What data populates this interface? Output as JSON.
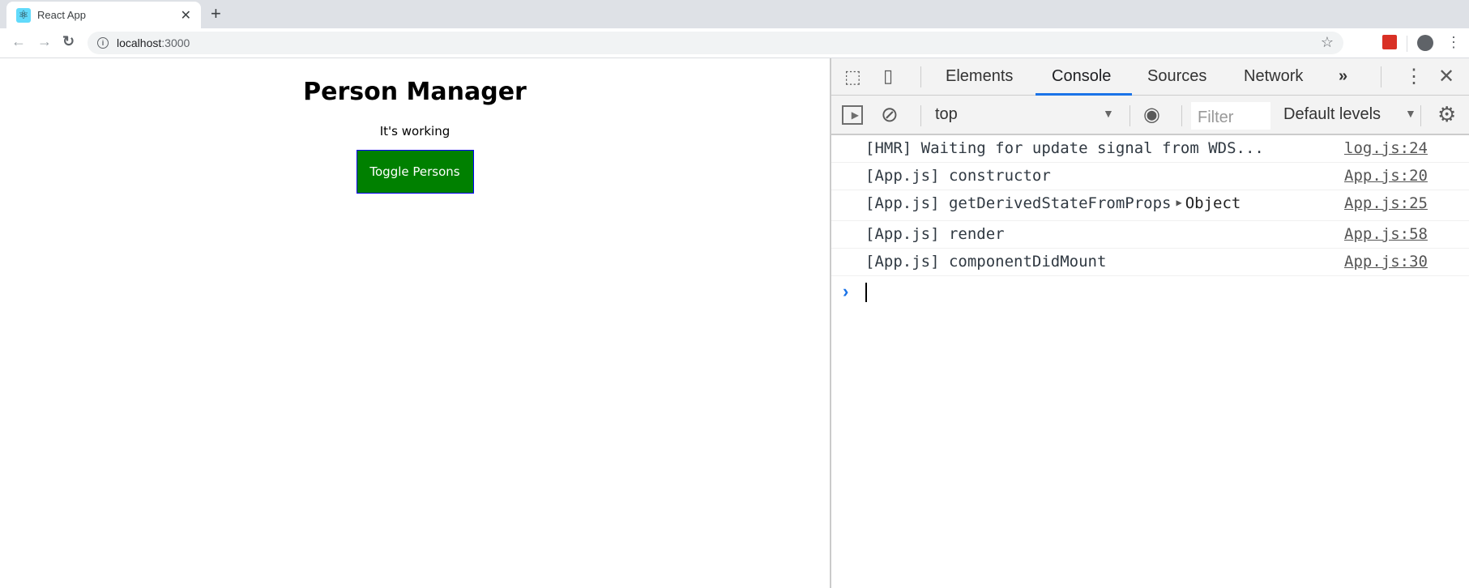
{
  "browser": {
    "tab_title": "React App",
    "tab_favicon": "react-logo-icon",
    "url_host": "localhost",
    "url_port": ":3000"
  },
  "page": {
    "heading": "Person Manager",
    "subtitle": "It's working",
    "toggle_button": "Toggle Persons",
    "toggle_button_bg": "#008000",
    "toggle_button_border": "#0000ff"
  },
  "devtools": {
    "tabs": [
      {
        "label": "Elements",
        "active": false
      },
      {
        "label": "Console",
        "active": true
      },
      {
        "label": "Sources",
        "active": false
      },
      {
        "label": "Network",
        "active": false
      }
    ],
    "more_tabs": "»",
    "context": "top",
    "filter_placeholder": "Filter",
    "levels": "Default levels",
    "accent": "#1a73e8",
    "console_rows": [
      {
        "message": "[HMR] Waiting for update signal from WDS...",
        "source": "log.js:24"
      },
      {
        "message": "[App.js] constructor",
        "source": "App.js:20"
      },
      {
        "message": "[App.js] getDerivedStateFromProps",
        "object": "Object",
        "source": "App.js:25"
      },
      {
        "message": "[App.js] render",
        "source": "App.js:58"
      },
      {
        "message": "[App.js] componentDidMount",
        "source": "App.js:30"
      }
    ]
  }
}
